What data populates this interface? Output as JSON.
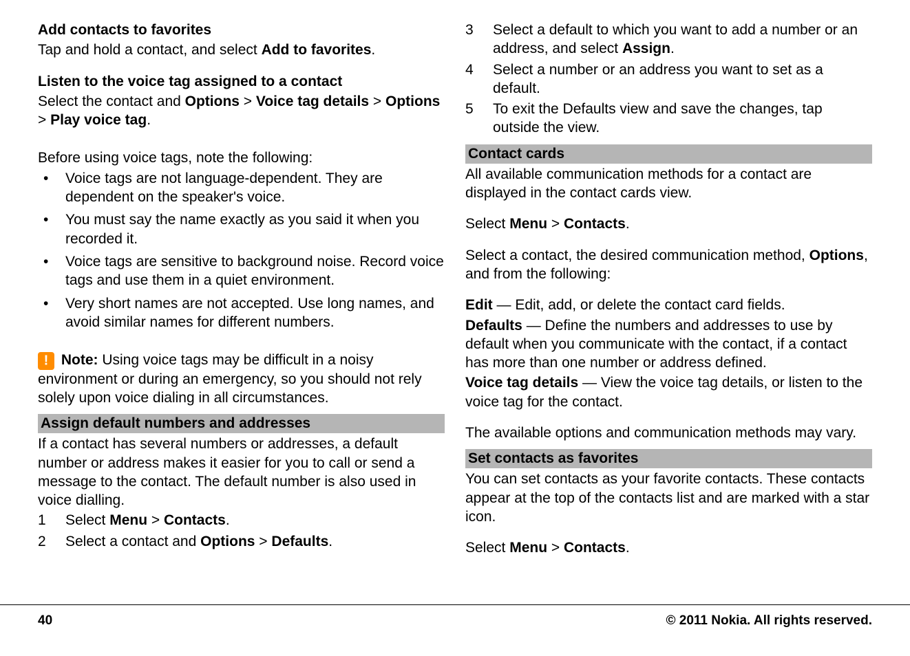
{
  "col1": {
    "s1": {
      "heading": "Add contacts to favorites",
      "text_parts": [
        "Tap and hold a contact, and select ",
        "Add to favorites",
        "."
      ]
    },
    "s2": {
      "heading": "Listen to the voice tag assigned to a contact",
      "text_parts": [
        "Select the contact and ",
        "Options",
        " > ",
        "Voice tag details",
        " > ",
        "Options",
        " > ",
        "Play voice tag",
        "."
      ]
    },
    "s3": {
      "intro": "Before using voice tags, note the following:",
      "bullets": [
        "Voice tags are not language-dependent. They are dependent on the speaker's voice.",
        "You must say the name exactly as you said it when you recorded it.",
        "Voice tags are sensitive to background noise. Record voice tags and use them in a quiet environment.",
        "Very short names are not accepted. Use long names, and avoid similar names for different numbers."
      ]
    },
    "note": {
      "label": "Note:",
      "text": " Using voice tags may be difficult in a noisy environment or during an emergency, so you should not rely solely upon voice dialing in all circumstances."
    },
    "s4": {
      "grey_heading": "Assign default numbers and addresses",
      "intro": "If a contact has several numbers or addresses, a default number or address makes it easier for you to call or send a message to the contact. The default number is also used in voice dialling.",
      "steps": [
        {
          "num": "1",
          "parts": [
            "Select ",
            "Menu",
            " > ",
            "Contacts",
            "."
          ]
        },
        {
          "num": "2",
          "parts": [
            "Select a contact and ",
            "Options",
            " > ",
            "Defaults",
            "."
          ]
        }
      ]
    }
  },
  "col2": {
    "steps_cont": [
      {
        "num": "3",
        "parts": [
          "Select a default to which you want to add a number or an address, and select ",
          "Assign",
          "."
        ]
      },
      {
        "num": "4",
        "parts": [
          "Select a number or an address you want to set as a default."
        ]
      },
      {
        "num": "5",
        "parts": [
          "To exit the Defaults view and save the changes, tap outside the view."
        ]
      }
    ],
    "s1": {
      "grey_heading": "Contact cards",
      "intro": "All available communication methods for a contact are displayed in the contact cards view.",
      "select_parts": [
        "Select ",
        "Menu",
        " > ",
        "Contacts",
        "."
      ],
      "select2_parts": [
        "Select a contact, the desired communication method, ",
        "Options",
        ", and from the following:"
      ],
      "options": [
        {
          "term": "Edit",
          "desc": " — Edit, add, or delete the contact card fields."
        },
        {
          "term": "Defaults",
          "desc": " — Define the numbers and addresses to use by default when you communicate with the contact, if a contact has more than one number or address defined."
        },
        {
          "term": "Voice tag details",
          "desc": " — View the voice tag details, or listen to the voice tag for the contact."
        }
      ],
      "outro": "The available options and communication methods may vary."
    },
    "s2": {
      "grey_heading": "Set contacts as favorites",
      "intro": "You can set contacts as your favorite contacts. These contacts appear at the top of the contacts list and are marked with a star icon.",
      "select_parts": [
        "Select ",
        "Menu",
        " > ",
        "Contacts",
        "."
      ]
    }
  },
  "footer": {
    "page": "40",
    "copyright": "© 2011 Nokia. All rights reserved."
  }
}
